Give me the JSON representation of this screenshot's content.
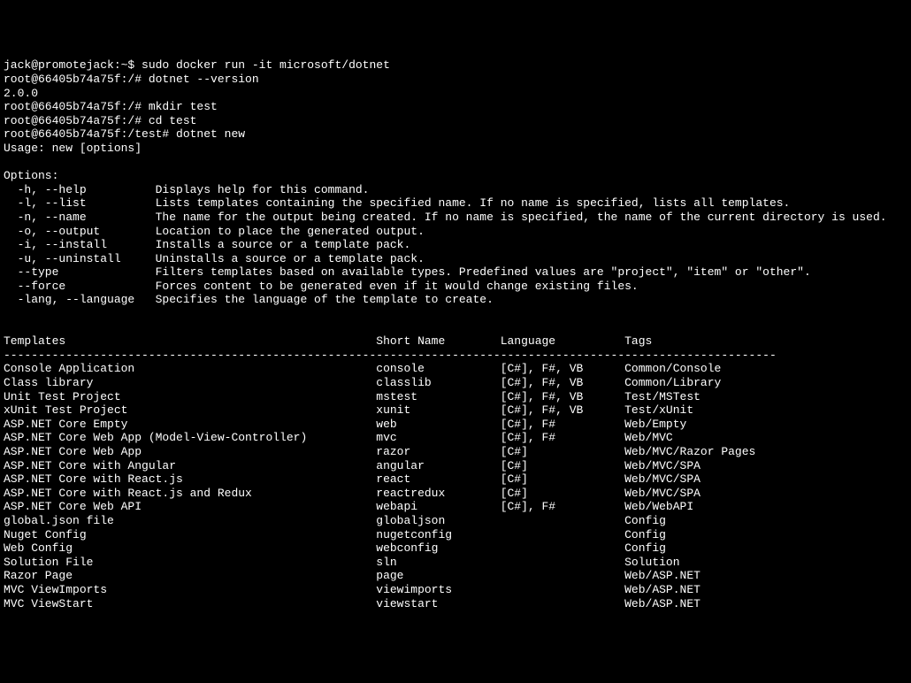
{
  "lines": [
    {
      "prompt": "jack@promotejack:~$ ",
      "command": "sudo docker run -it microsoft/dotnet"
    },
    {
      "prompt": "root@66405b74a75f:/# ",
      "command": "dotnet --version"
    },
    {
      "text": "2.0.0"
    },
    {
      "prompt": "root@66405b74a75f:/# ",
      "command": "mkdir test"
    },
    {
      "prompt": "root@66405b74a75f:/# ",
      "command": "cd test"
    },
    {
      "prompt": "root@66405b74a75f:/test# ",
      "command": "dotnet new"
    },
    {
      "text": "Usage: new [options]"
    },
    {
      "text": ""
    },
    {
      "text": "Options:"
    },
    {
      "text": "  -h, --help          Displays help for this command."
    },
    {
      "text": "  -l, --list          Lists templates containing the specified name. If no name is specified, lists all templates."
    },
    {
      "text": "  -n, --name          The name for the output being created. If no name is specified, the name of the current directory is used."
    },
    {
      "text": "  -o, --output        Location to place the generated output."
    },
    {
      "text": "  -i, --install       Installs a source or a template pack."
    },
    {
      "text": "  -u, --uninstall     Uninstalls a source or a template pack."
    },
    {
      "text": "  --type              Filters templates based on available types. Predefined values are \"project\", \"item\" or \"other\"."
    },
    {
      "text": "  --force             Forces content to be generated even if it would change existing files."
    },
    {
      "text": "  -lang, --language   Specifies the language of the template to create."
    },
    {
      "text": ""
    },
    {
      "text": ""
    }
  ],
  "table": {
    "header": {
      "c1": "Templates",
      "c2": "Short Name",
      "c3": "Language",
      "c4": "Tags"
    },
    "separator": "----------------------------------------------------------------------------------------------------------------",
    "rows": [
      {
        "c1": "Console Application",
        "c2": "console",
        "c3": "[C#], F#, VB",
        "c4": "Common/Console"
      },
      {
        "c1": "Class library",
        "c2": "classlib",
        "c3": "[C#], F#, VB",
        "c4": "Common/Library"
      },
      {
        "c1": "Unit Test Project",
        "c2": "mstest",
        "c3": "[C#], F#, VB",
        "c4": "Test/MSTest"
      },
      {
        "c1": "xUnit Test Project",
        "c2": "xunit",
        "c3": "[C#], F#, VB",
        "c4": "Test/xUnit"
      },
      {
        "c1": "ASP.NET Core Empty",
        "c2": "web",
        "c3": "[C#], F#",
        "c4": "Web/Empty"
      },
      {
        "c1": "ASP.NET Core Web App (Model-View-Controller)",
        "c2": "mvc",
        "c3": "[C#], F#",
        "c4": "Web/MVC"
      },
      {
        "c1": "ASP.NET Core Web App",
        "c2": "razor",
        "c3": "[C#]",
        "c4": "Web/MVC/Razor Pages"
      },
      {
        "c1": "ASP.NET Core with Angular",
        "c2": "angular",
        "c3": "[C#]",
        "c4": "Web/MVC/SPA"
      },
      {
        "c1": "ASP.NET Core with React.js",
        "c2": "react",
        "c3": "[C#]",
        "c4": "Web/MVC/SPA"
      },
      {
        "c1": "ASP.NET Core with React.js and Redux",
        "c2": "reactredux",
        "c3": "[C#]",
        "c4": "Web/MVC/SPA"
      },
      {
        "c1": "ASP.NET Core Web API",
        "c2": "webapi",
        "c3": "[C#], F#",
        "c4": "Web/WebAPI"
      },
      {
        "c1": "global.json file",
        "c2": "globaljson",
        "c3": "",
        "c4": "Config"
      },
      {
        "c1": "Nuget Config",
        "c2": "nugetconfig",
        "c3": "",
        "c4": "Config"
      },
      {
        "c1": "Web Config",
        "c2": "webconfig",
        "c3": "",
        "c4": "Config"
      },
      {
        "c1": "Solution File",
        "c2": "sln",
        "c3": "",
        "c4": "Solution"
      },
      {
        "c1": "Razor Page",
        "c2": "page",
        "c3": "",
        "c4": "Web/ASP.NET"
      },
      {
        "c1": "MVC ViewImports",
        "c2": "viewimports",
        "c3": "",
        "c4": "Web/ASP.NET"
      },
      {
        "c1": "MVC ViewStart",
        "c2": "viewstart",
        "c3": "",
        "c4": "Web/ASP.NET"
      }
    ]
  },
  "columns": {
    "c1": 0,
    "c2": 54,
    "c3": 72,
    "c4": 90
  }
}
